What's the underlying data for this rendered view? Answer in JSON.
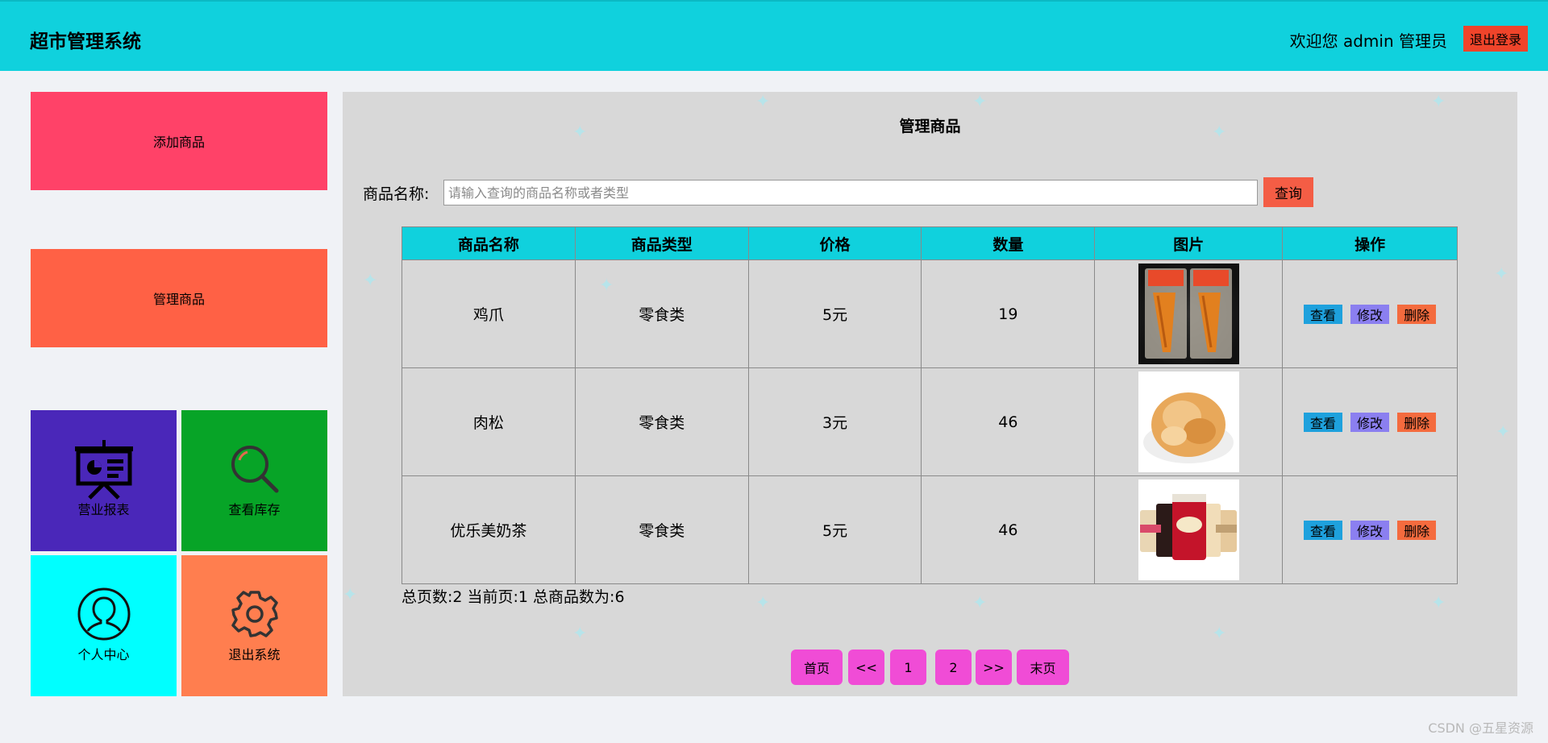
{
  "header": {
    "brand": "超市管理系统",
    "welcome": "欢迎您 admin 管理员",
    "logout_label": "退出登录"
  },
  "sidebar": {
    "add_label": "添加商品",
    "manage_label": "管理商品",
    "tiles": [
      {
        "label": "营业报表",
        "icon": "presentation-board-icon",
        "color": "#4a27b9"
      },
      {
        "label": "查看库存",
        "icon": "magnifier-icon",
        "color": "#07a427"
      },
      {
        "label": "个人中心",
        "icon": "user-icon",
        "color": "#00ffff"
      },
      {
        "label": "退出系统",
        "icon": "gear-icon",
        "color": "#ff7e4f"
      }
    ]
  },
  "main": {
    "title": "管理商品",
    "search": {
      "label": "商品名称:",
      "placeholder": "请输入查询的商品名称或者类型",
      "button": "查询"
    },
    "table": {
      "headers": [
        "商品名称",
        "商品类型",
        "价格",
        "数量",
        "图片",
        "操作"
      ],
      "rows": [
        {
          "name": "鸡爪",
          "type": "零食类",
          "price": "5元",
          "qty": "19",
          "image": "chicken-feet-image"
        },
        {
          "name": "肉松",
          "type": "零食类",
          "price": "3元",
          "qty": "46",
          "image": "pork-floss-image"
        },
        {
          "name": "优乐美奶茶",
          "type": "零食类",
          "price": "5元",
          "qty": "46",
          "image": "milk-tea-image"
        }
      ],
      "actions": {
        "view": "查看",
        "edit": "修改",
        "delete": "删除"
      }
    },
    "page_info": "总页数:2 当前页:1 总商品数为:6",
    "pagination": {
      "first": "首页",
      "prev": "<<",
      "page1": "1",
      "page2": "2",
      "next": ">>",
      "last": "末页"
    }
  },
  "watermark": "CSDN @五星资源",
  "colors": {
    "header": "#10d1dd",
    "add": "#ff4268",
    "manage": "#ff6145",
    "pager": "#f04cd6",
    "query": "#f45d45"
  }
}
